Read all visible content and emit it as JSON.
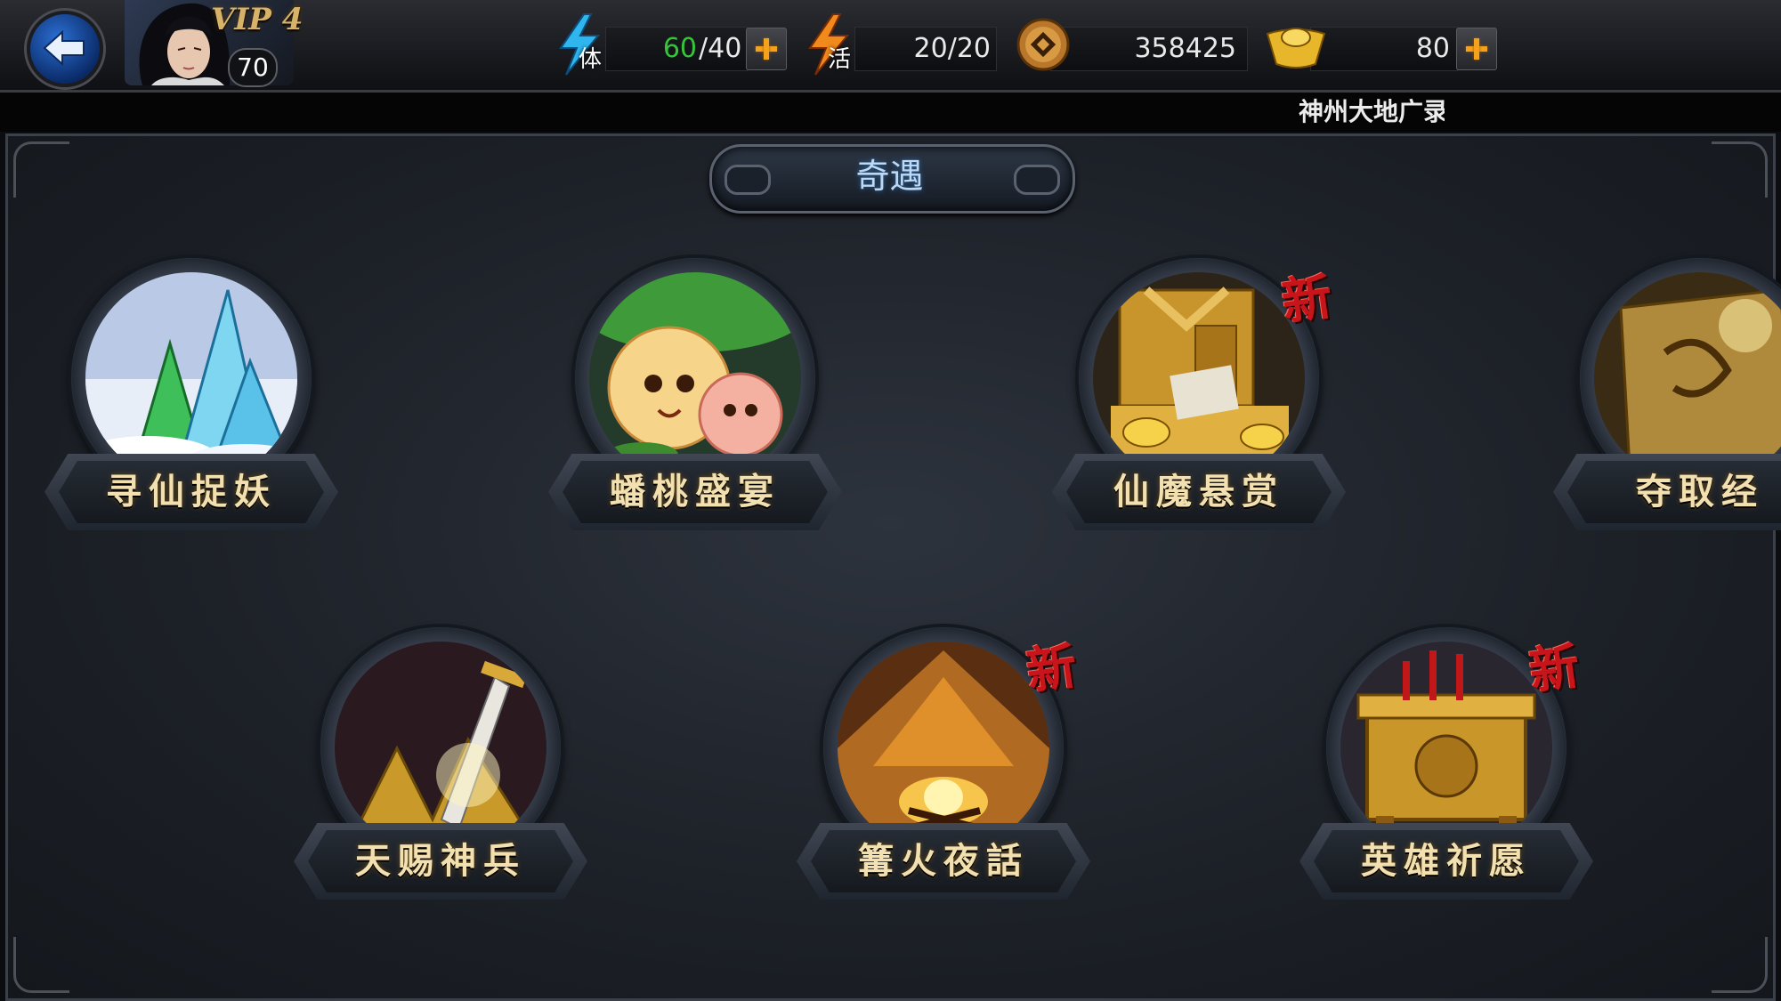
{
  "header": {
    "vip_label": "VIP 4",
    "player_level": "70",
    "stamina": {
      "icon_char": "体",
      "current": "60",
      "max": "/40"
    },
    "vitality": {
      "icon_char": "活",
      "value": "20/20"
    },
    "coins": {
      "value": "358425"
    },
    "gold_ingots": {
      "value": "80"
    }
  },
  "marquee": {
    "text": "神州大地广录"
  },
  "page": {
    "title": "奇遇"
  },
  "adventures": [
    {
      "label": "寻仙捉妖",
      "new": false
    },
    {
      "label": "蟠桃盛宴",
      "new": false
    },
    {
      "label": "仙魔悬赏",
      "new": true
    },
    {
      "label": "夺取经",
      "new": false
    },
    {
      "label": "天赐神兵",
      "new": false
    },
    {
      "label": "篝火夜話",
      "new": true
    },
    {
      "label": "英雄祈愿",
      "new": true
    }
  ],
  "new_badge_text": "新",
  "colors": {
    "accent_orange": "#f4a21c",
    "stamina_current": "#35c43a",
    "title_text": "#bfd8f2",
    "new_badge": "#c8151b"
  }
}
